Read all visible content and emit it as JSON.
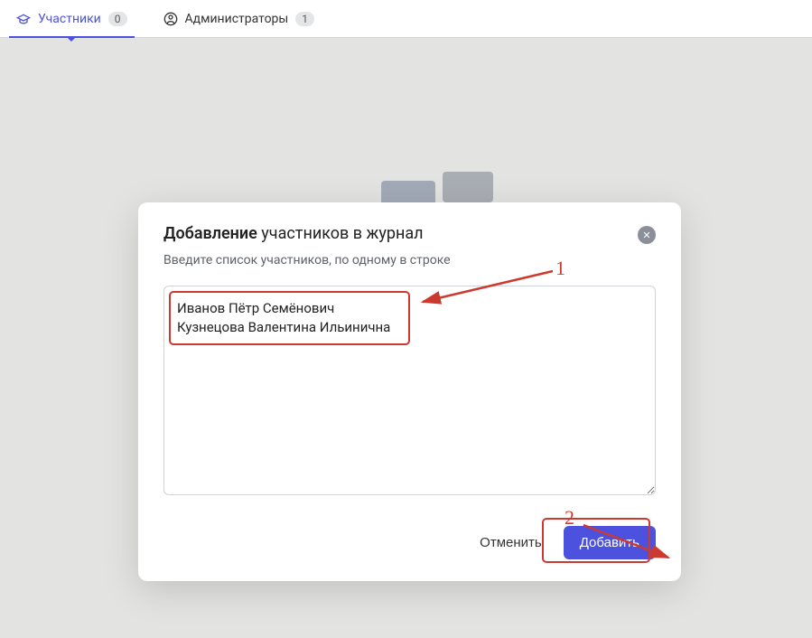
{
  "tabs": {
    "participants": {
      "label": "Участники",
      "count": "0"
    },
    "admins": {
      "label": "Администраторы",
      "count": "1"
    }
  },
  "modal": {
    "title_bold": "Добавление",
    "title_rest": " участников в журнал",
    "subtitle": "Введите список участников, по одному в строке",
    "textarea_value": "Иванов Пётр Семёнович\nКузнецова Валентина Ильинична",
    "cancel": "Отменить",
    "submit": "Добавить"
  },
  "annotations": {
    "num1": "1",
    "num2": "2"
  }
}
